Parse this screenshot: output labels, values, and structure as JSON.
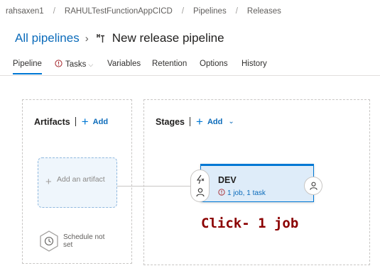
{
  "breadcrumb": {
    "items": [
      "rahsaxen1",
      "RAHULTestFunctionAppCICD",
      "Pipelines",
      "Releases"
    ],
    "separator": "/"
  },
  "header": {
    "back_link": "All pipelines",
    "chevron": "›",
    "title": "New release pipeline",
    "title_icon": "release-pipeline-icon"
  },
  "tabs": [
    {
      "label": "Pipeline",
      "active": true
    },
    {
      "label": "Tasks",
      "has_warning": true,
      "has_dropdown": true
    },
    {
      "label": "Variables"
    },
    {
      "label": "Retention"
    },
    {
      "label": "Options"
    },
    {
      "label": "History"
    }
  ],
  "artifacts": {
    "heading": "Artifacts",
    "add_label": "Add",
    "add_artifact_label": "Add an artifact",
    "schedule_label": "Schedule not set"
  },
  "stages": {
    "heading": "Stages",
    "add_label": "Add",
    "stage": {
      "name": "DEV",
      "status": "1 job, 1 task",
      "status_icon": "warning-circle-icon"
    }
  },
  "annotation": "Click- 1 job",
  "colors": {
    "accent": "#0078d4",
    "link": "#0b6bba",
    "stage_background": "#deecf9",
    "warning": "#a4262c",
    "annotation": "#8b0000"
  }
}
